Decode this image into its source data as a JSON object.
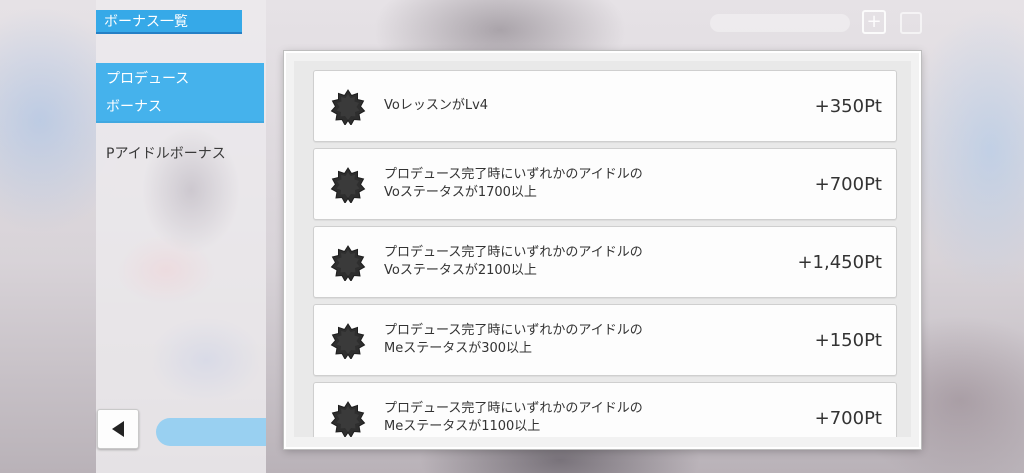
{
  "sidebar": {
    "title": "ボーナス一覧",
    "active_item": {
      "line1": "プロデュース",
      "line2": "ボーナス"
    },
    "item": "Pアイドルボーナス"
  },
  "bonuses": [
    {
      "line1": "VoレッスンがLv4",
      "line2": "",
      "points": "+350Pt"
    },
    {
      "line1": "プロデュース完了時にいずれかのアイドルの",
      "line2": "Voステータスが1700以上",
      "points": "+700Pt"
    },
    {
      "line1": "プロデュース完了時にいずれかのアイドルの",
      "line2": "Voステータスが2100以上",
      "points": "+1,450Pt"
    },
    {
      "line1": "プロデュース完了時にいずれかのアイドルの",
      "line2": "Meステータスが300以上",
      "points": "+150Pt"
    },
    {
      "line1": "プロデュース完了時にいずれかのアイドルの",
      "line2": "Meステータスが1100以上",
      "points": "+700Pt"
    }
  ],
  "icons": {
    "back": "back-arrow-icon",
    "bonus": "badge-star-icon",
    "add": "plus-icon"
  },
  "colors": {
    "accent": "#36a9e8",
    "active": "#45b2ec",
    "icon": "#2e2e2e"
  }
}
